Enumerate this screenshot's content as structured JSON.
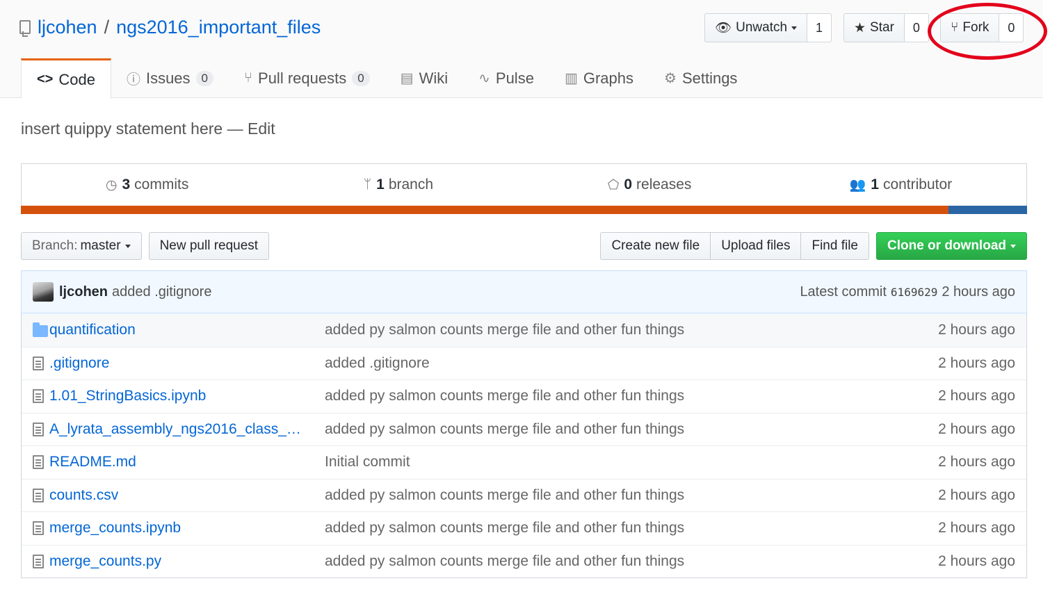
{
  "repo": {
    "owner": "ljcohen",
    "separator": "/",
    "name": "ngs2016_important_files"
  },
  "actions": {
    "watch": {
      "label": "Unwatch",
      "count": "1"
    },
    "star": {
      "label": "Star",
      "count": "0"
    },
    "fork": {
      "label": "Fork",
      "count": "0"
    }
  },
  "tabs": [
    {
      "label": "Code",
      "icon": "code-icon",
      "glyph": "<>"
    },
    {
      "label": "Issues",
      "icon": "issue-icon",
      "glyph": "ⓘ",
      "count": "0"
    },
    {
      "label": "Pull requests",
      "icon": "pull-request-icon",
      "glyph": "⑂",
      "count": "0"
    },
    {
      "label": "Wiki",
      "icon": "book-icon",
      "glyph": "▤"
    },
    {
      "label": "Pulse",
      "icon": "pulse-icon",
      "glyph": "∿"
    },
    {
      "label": "Graphs",
      "icon": "graph-icon",
      "glyph": "▥"
    },
    {
      "label": "Settings",
      "icon": "gear-icon",
      "glyph": "⚙"
    }
  ],
  "description": "insert quippy statement here — Edit",
  "summary": {
    "commits": {
      "num": "3",
      "label": "commits"
    },
    "branches": {
      "num": "1",
      "label": "branch"
    },
    "releases": {
      "num": "0",
      "label": "releases"
    },
    "contributors": {
      "num": "1",
      "label": "contributor"
    }
  },
  "languages": {
    "color1": "#d4510c",
    "color2": "#2a65a4"
  },
  "nav": {
    "branch_prefix": "Branch:",
    "branch_name": "master",
    "new_pr": "New pull request",
    "create_file": "Create new file",
    "upload_files": "Upload files",
    "find_file": "Find file",
    "clone": "Clone or download"
  },
  "latest_commit": {
    "author": "ljcohen",
    "message": "added .gitignore",
    "label": "Latest commit",
    "sha": "6169629",
    "age": "2 hours ago"
  },
  "files": [
    {
      "type": "folder",
      "name": "quantification",
      "message": "added py salmon counts merge file and other fun things",
      "age": "2 hours ago"
    },
    {
      "type": "file",
      "name": ".gitignore",
      "message": "added .gitignore",
      "age": "2 hours ago"
    },
    {
      "type": "file",
      "name": "1.01_StringBasics.ipynb",
      "message": "added py salmon counts merge file and other fun things",
      "age": "2 hours ago"
    },
    {
      "type": "file",
      "name": "A_lyrata_assembly_ngs2016_class_…",
      "message": "added py salmon counts merge file and other fun things",
      "age": "2 hours ago"
    },
    {
      "type": "file",
      "name": "README.md",
      "message": "Initial commit",
      "age": "2 hours ago"
    },
    {
      "type": "file",
      "name": "counts.csv",
      "message": "added py salmon counts merge file and other fun things",
      "age": "2 hours ago"
    },
    {
      "type": "file",
      "name": "merge_counts.ipynb",
      "message": "added py salmon counts merge file and other fun things",
      "age": "2 hours ago"
    },
    {
      "type": "file",
      "name": "merge_counts.py",
      "message": "added py salmon counts merge file and other fun things",
      "age": "2 hours ago"
    }
  ]
}
